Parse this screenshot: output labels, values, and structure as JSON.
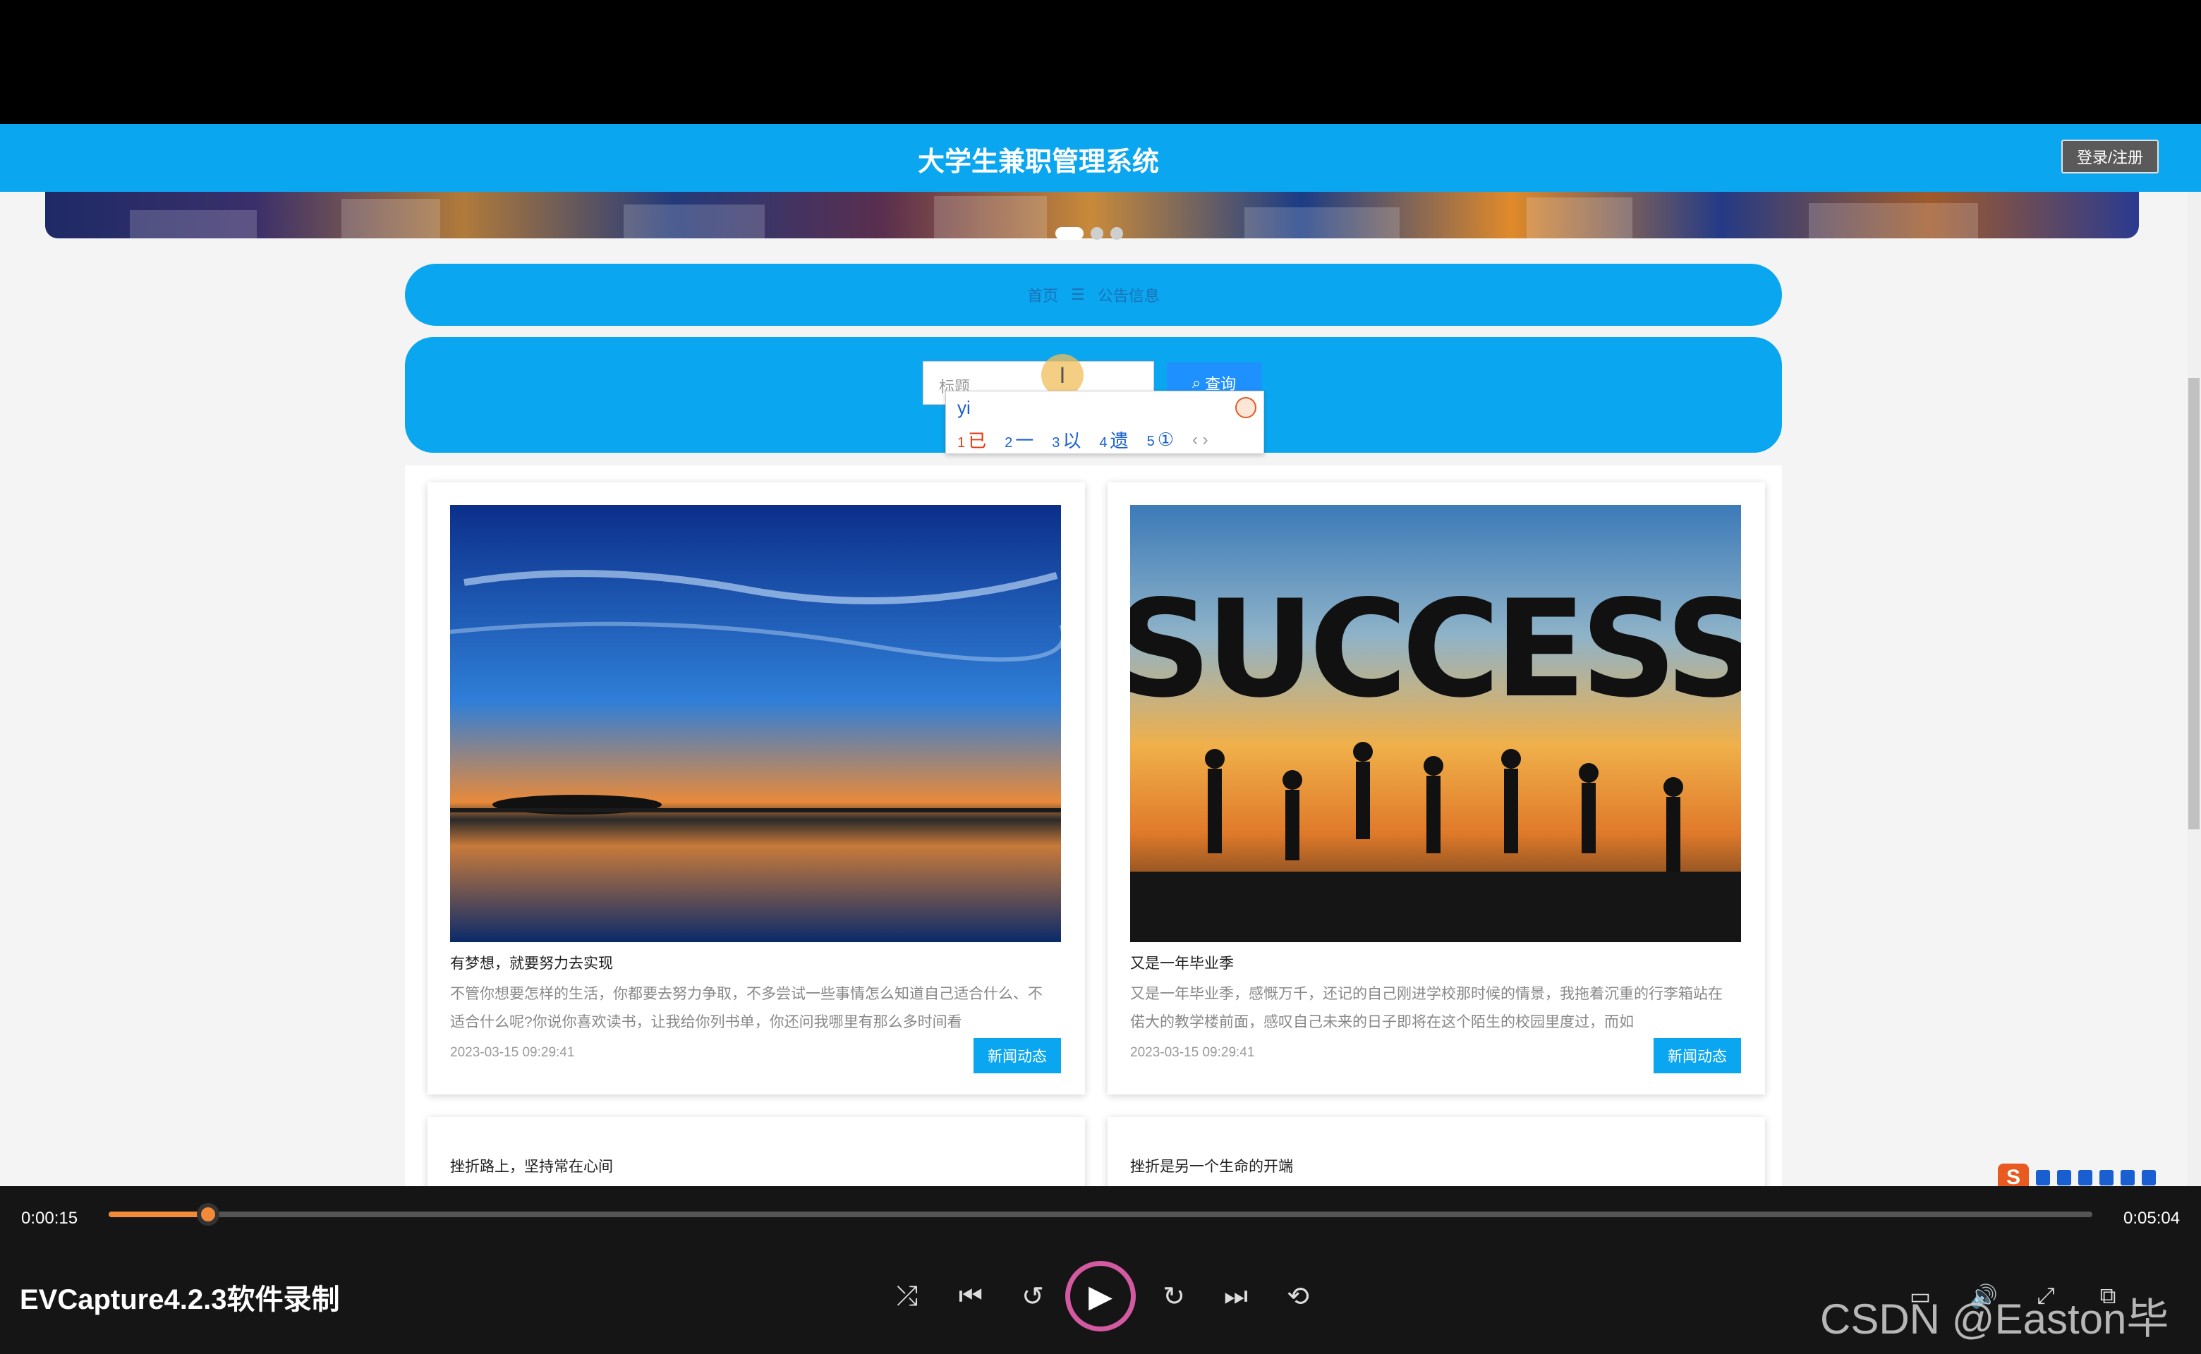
{
  "site": {
    "title": "大学生兼职管理系统",
    "login_label": "登录/注册"
  },
  "breadcrumb": {
    "home": "首页",
    "separator": "☰",
    "current": "公告信息"
  },
  "search": {
    "placeholder": "标题",
    "button_label": "查询",
    "search_icon": "search-icon"
  },
  "ime": {
    "typed": "yi",
    "candidates": [
      {
        "num": "1",
        "text": "已"
      },
      {
        "num": "2",
        "text": "一"
      },
      {
        "num": "3",
        "text": "以"
      },
      {
        "num": "4",
        "text": "遗"
      },
      {
        "num": "5",
        "text": "①"
      }
    ],
    "nav": "‹ ›"
  },
  "cards": [
    {
      "title": "有梦想，就要努力去实现",
      "desc": "不管你想要怎样的生活，你都要去努力争取，不多尝试一些事情怎么知道自己适合什么、不适合什么呢?你说你喜欢读书，让我给你列书单，你还问我哪里有那么多时间看",
      "date": "2023-03-15 09:29:41",
      "tag": "新闻动态"
    },
    {
      "title": "又是一年毕业季",
      "desc": "又是一年毕业季，感慨万千，还记的自己刚进学校那时候的情景，我拖着沉重的行李箱站在偌大的教学楼前面，感叹自己未来的日子即将在这个陌生的校园里度过，而如",
      "date": "2023-03-15 09:29:41",
      "tag": "新闻动态",
      "image_text": "SUCCESS"
    },
    {
      "title": "挫折路上，坚持常在心间"
    },
    {
      "title": "挫折是另一个生命的开端"
    }
  ],
  "player": {
    "current_time": "0:00:15",
    "total_time": "0:05:04",
    "progress": 0.05,
    "app_name": "EVCapture4.2.3软件录制",
    "watermark": "CSDN @Easton毕设",
    "accent_color": "#f28a3a"
  }
}
